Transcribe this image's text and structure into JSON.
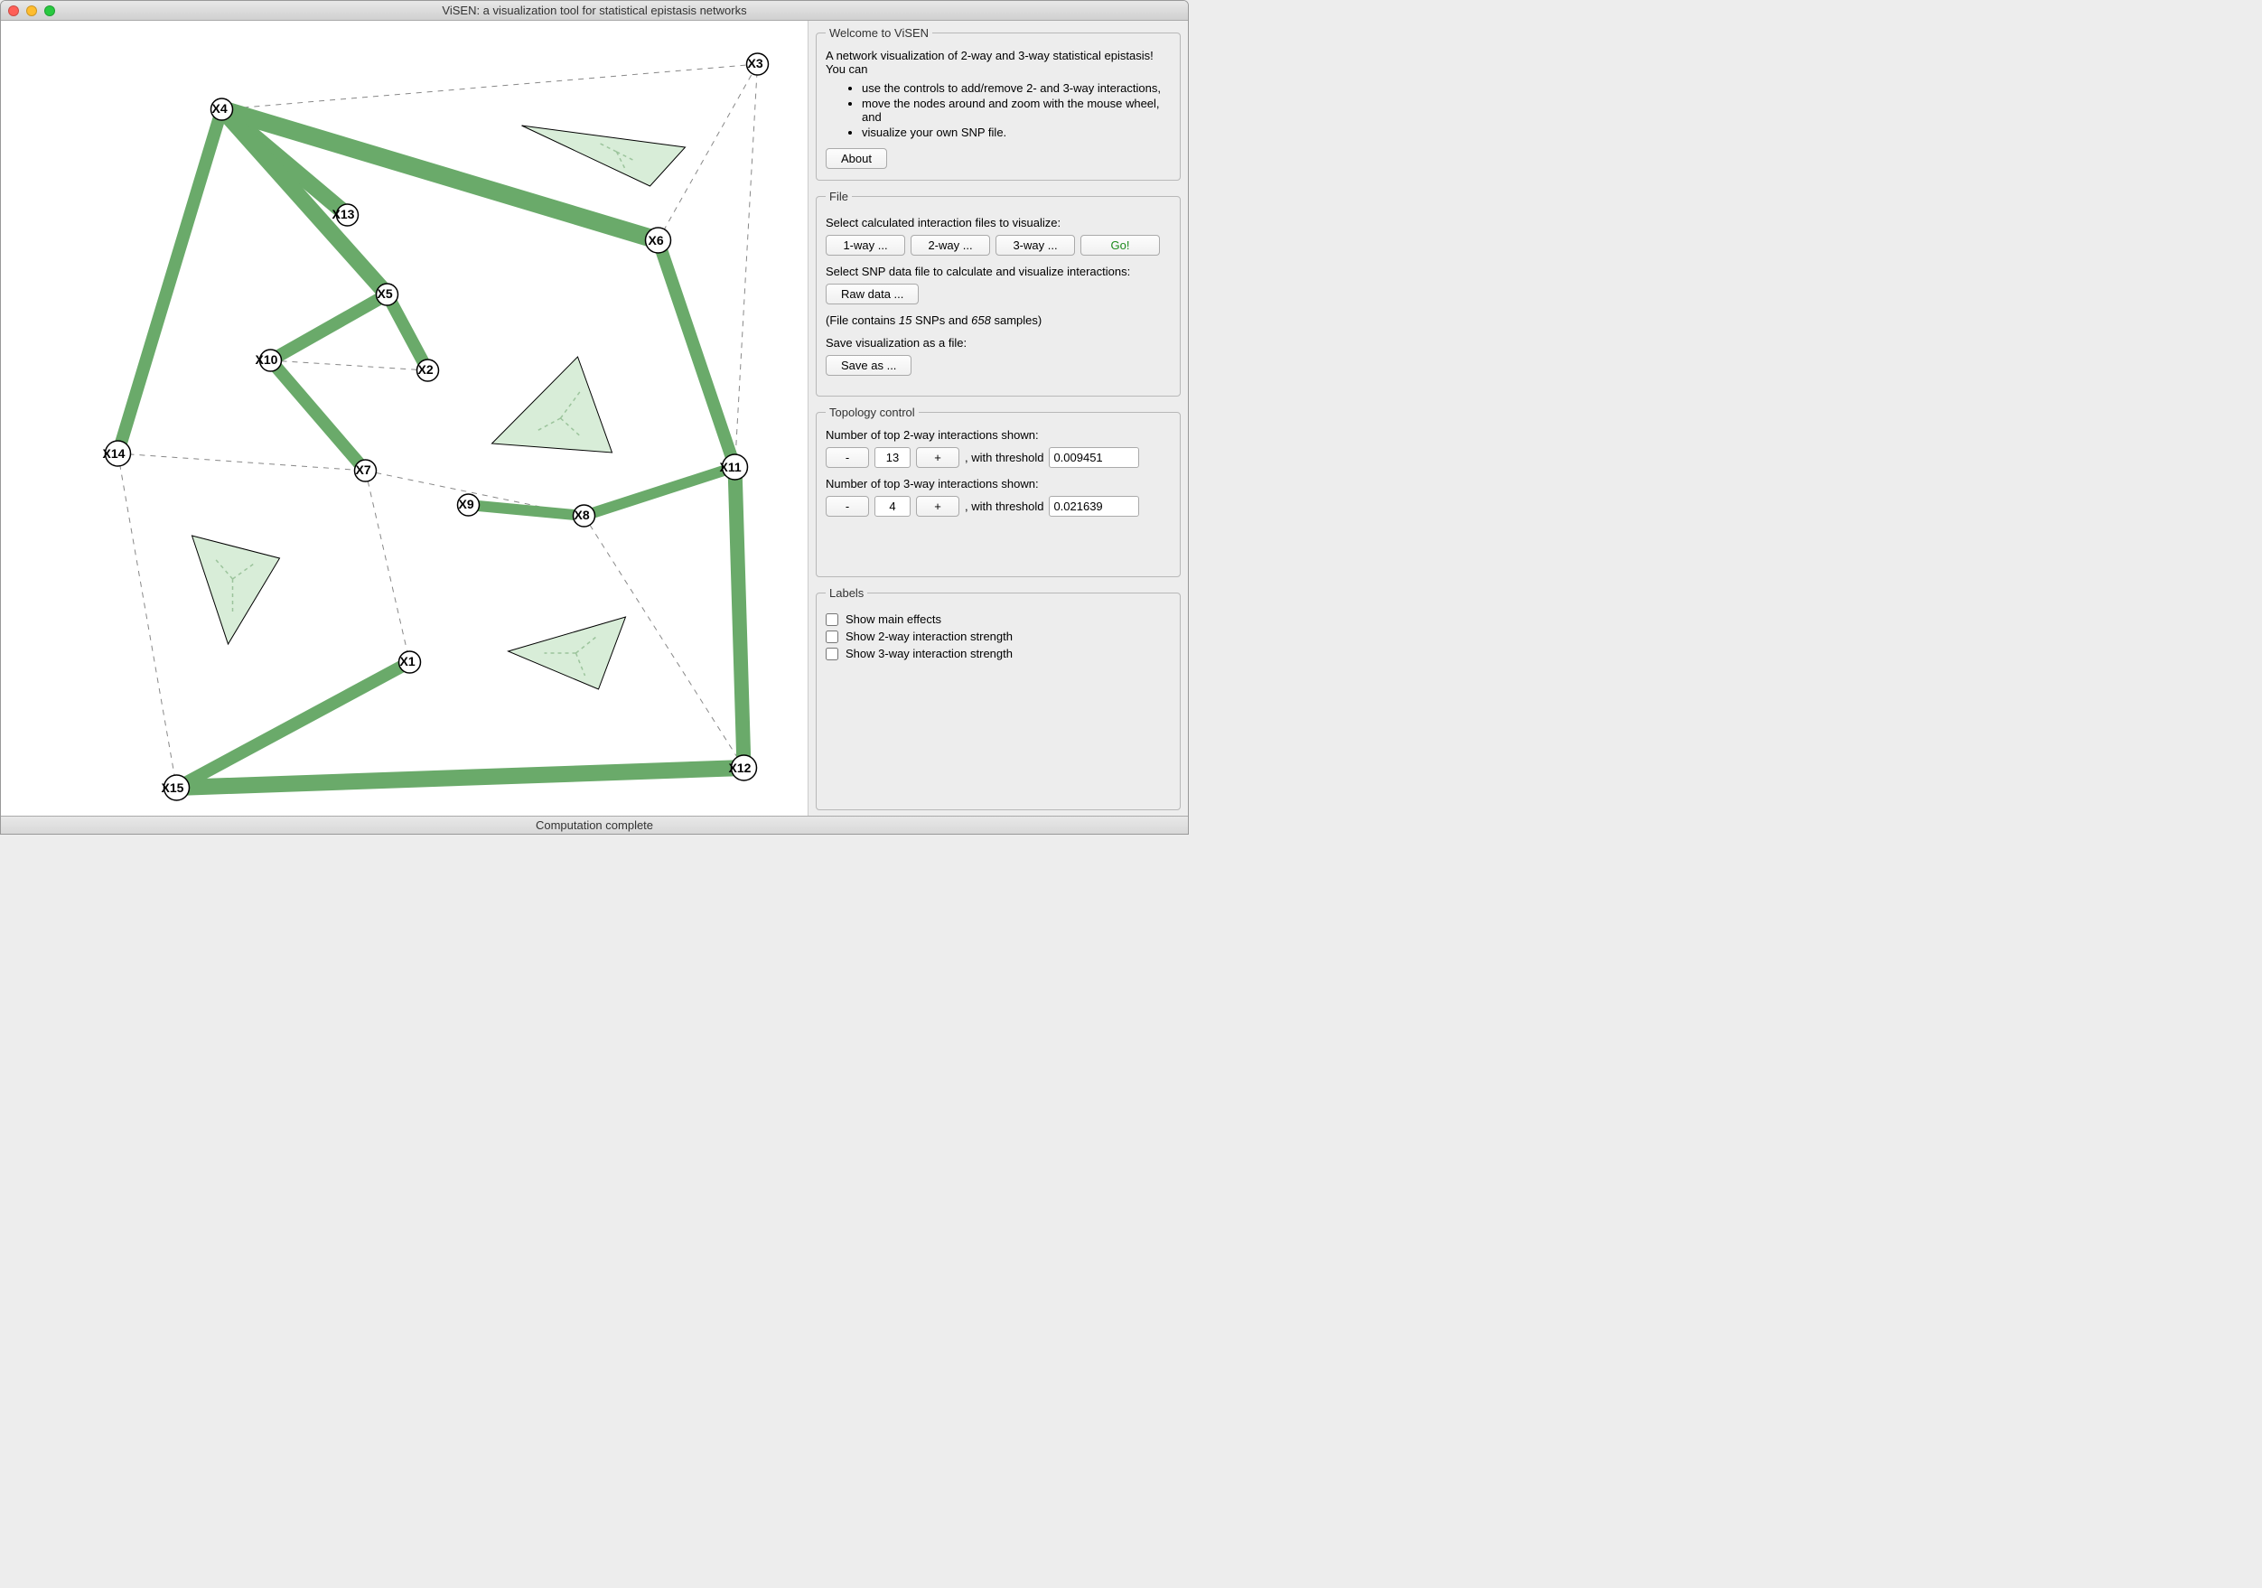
{
  "window": {
    "title": "ViSEN: a visualization tool for statistical epistasis networks"
  },
  "welcome": {
    "legend": "Welcome to ViSEN",
    "intro": "A network visualization of 2-way and 3-way statistical epistasis! You can",
    "bullets": [
      "use the controls to add/remove 2- and 3-way interactions,",
      "move the nodes around and zoom with the mouse wheel, and",
      "visualize your own SNP file."
    ],
    "about_label": "About"
  },
  "file": {
    "legend": "File",
    "select_calc_label": "Select calculated interaction files to visualize:",
    "oneway_label": "1-way ...",
    "twoway_label": "2-way ...",
    "threeway_label": "3-way ...",
    "go_label": "Go!",
    "select_snp_label": "Select SNP data file to calculate and visualize interactions:",
    "rawdata_label": "Raw data ...",
    "info_prefix": "(File contains ",
    "snp_count": "15",
    "info_mid": " SNPs and ",
    "sample_count": "658",
    "info_suffix": " samples)",
    "save_label": "Save visualization as a file:",
    "saveas_label": "Save as ..."
  },
  "topology": {
    "legend": "Topology control",
    "twoway_label": "Number of top 2-way interactions shown:",
    "twoway_value": "13",
    "twoway_thresh_label": ", with threshold",
    "twoway_thresh": "0.009451",
    "threeway_label": "Number of top 3-way interactions shown:",
    "threeway_value": "4",
    "threeway_thresh_label": ", with threshold",
    "threeway_thresh": "0.021639",
    "minus": "-",
    "plus": "+"
  },
  "labels": {
    "legend": "Labels",
    "main_effects": "Show main effects",
    "twoway_strength": "Show 2-way interaction strength",
    "threeway_strength": "Show 3-way interaction strength"
  },
  "status": {
    "text": "Computation complete"
  },
  "network": {
    "nodes": {
      "X1": "X1",
      "X2": "X2",
      "X3": "X3",
      "X4": "X4",
      "X5": "X5",
      "X6": "X6",
      "X7": "X7",
      "X8": "X8",
      "X9": "X9",
      "X10": "X10",
      "X11": "X11",
      "X12": "X12",
      "X13": "X13",
      "X14": "X14",
      "X15": "X15"
    }
  }
}
